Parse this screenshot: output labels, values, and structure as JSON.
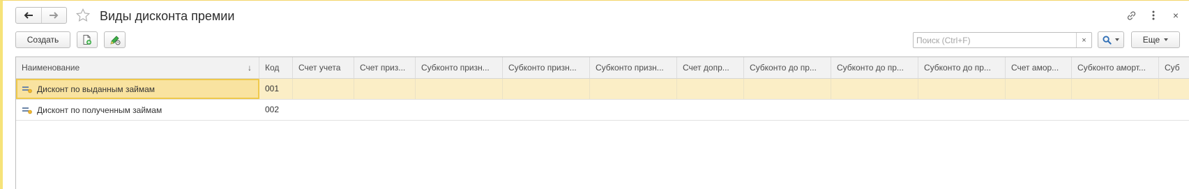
{
  "window": {
    "title": "Виды дисконта премии",
    "back_icon": "arrow-left-icon",
    "forward_icon": "arrow-right-icon",
    "favorite_icon": "star-icon",
    "link_icon": "link-icon",
    "more_icon": "vertical-dots-icon",
    "close_icon": "close-icon",
    "close_glyph": "×"
  },
  "toolbar": {
    "create_label": "Создать",
    "copy_icon": "copy-document-icon",
    "edit_icon": "edit-pencil-icon",
    "search_placeholder": "Поиск (Ctrl+F)",
    "search_value": "",
    "clear_glyph": "×",
    "search_icon": "magnifier-icon",
    "more_label": "Еще"
  },
  "colors": {
    "accent_border": "#f6e37a",
    "selected_row": "#fbeec6",
    "selected_cell": "#f9e3a0",
    "search_icon": "#2f6fb6"
  },
  "table": {
    "columns": [
      "Наименование",
      "Код",
      "Счет учета",
      "Счет приз...",
      "Субконто призн...",
      "Субконто призн...",
      "Субконто призн...",
      "Счет допр...",
      "Субконто до пр...",
      "Субконто до пр...",
      "Субконто до пр...",
      "Счет амор...",
      "Субконто аморт...",
      "Суб"
    ],
    "sort_glyph": "↓",
    "rows": [
      {
        "name": "Дисконт по выданным займам",
        "code": "001",
        "selected": true
      },
      {
        "name": "Дисконт по полученным займам",
        "code": "002",
        "selected": false
      }
    ]
  }
}
